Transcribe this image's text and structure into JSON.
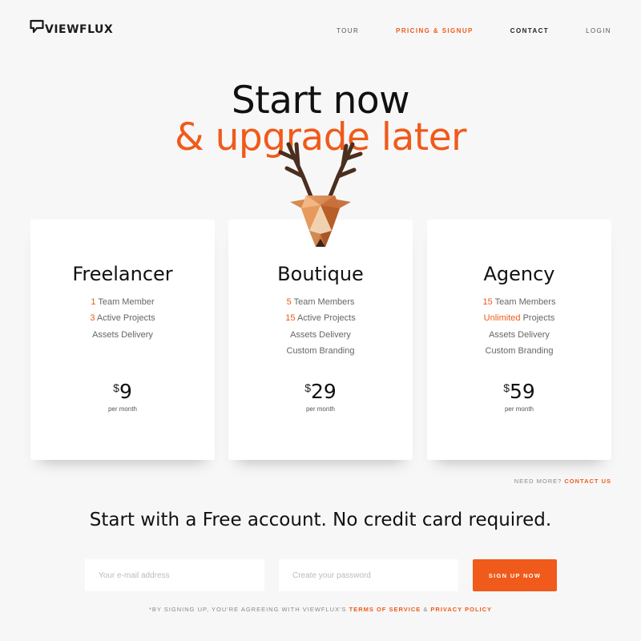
{
  "brand": {
    "name": "VIEWFLUX",
    "logo_icon": "speech-bubble-v-icon"
  },
  "nav": {
    "items": [
      {
        "label": "TOUR"
      },
      {
        "label": "PRICING & SIGNUP"
      },
      {
        "label": "CONTACT"
      },
      {
        "label": "LOGIN"
      }
    ]
  },
  "hero": {
    "line1": "Start now",
    "line2": "& upgrade later",
    "illustration_icon": "low-poly-deer-head-icon"
  },
  "plans": [
    {
      "name": "Freelancer",
      "features": [
        {
          "highlight": "1",
          "text": " Team Member"
        },
        {
          "highlight": "3",
          "text": " Active Projects"
        },
        {
          "highlight": "",
          "text": "Assets Delivery"
        }
      ],
      "currency": "$",
      "price": "9",
      "period": "per month"
    },
    {
      "name": "Boutique",
      "features": [
        {
          "highlight": "5",
          "text": " Team Members"
        },
        {
          "highlight": "15",
          "text": " Active Projects"
        },
        {
          "highlight": "",
          "text": "Assets Delivery"
        },
        {
          "highlight": "",
          "text": "Custom Branding"
        }
      ],
      "currency": "$",
      "price": "29",
      "period": "per month"
    },
    {
      "name": "Agency",
      "features": [
        {
          "highlight": "15",
          "text": " Team Members"
        },
        {
          "highlight": "Unlimited",
          "text": " Projects"
        },
        {
          "highlight": "",
          "text": "Assets Delivery"
        },
        {
          "highlight": "",
          "text": "Custom Branding"
        }
      ],
      "currency": "$",
      "price": "59",
      "period": "per month"
    }
  ],
  "need_more": {
    "text": "NEED MORE? ",
    "link": "CONTACT US"
  },
  "free_heading": "Start with a Free account. No credit card required.",
  "form": {
    "email_placeholder": "Your e-mail address",
    "password_placeholder": "Create your password",
    "submit_label": "SIGN UP NOW"
  },
  "terms": {
    "prefix": "*BY SIGNING UP, YOU'RE AGREEING WITH VIEWFLUX'S ",
    "tos": "TERMS OF SERVICE",
    "sep": " & ",
    "privacy": "PRIVACY POLICY"
  },
  "colors": {
    "accent": "#f05a1a",
    "background": "#f7f7f7",
    "card": "#ffffff",
    "text": "#111111"
  }
}
